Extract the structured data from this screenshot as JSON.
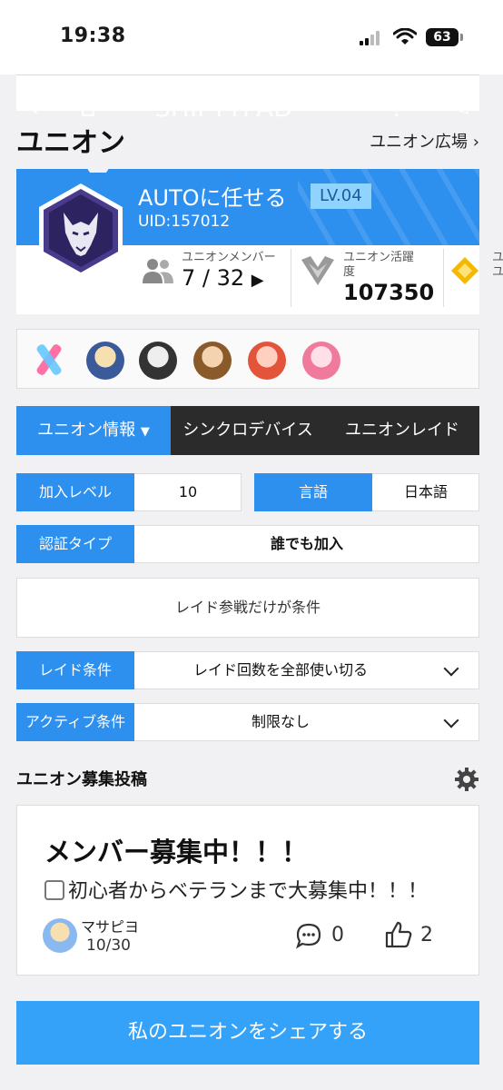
{
  "status_bar": {
    "time": "19:38",
    "battery": "63"
  },
  "nav": {
    "ghost_brand": "SHIFTYPAD"
  },
  "header": {
    "title": "ユニオン",
    "plaza_link": "ユニオン広場"
  },
  "union": {
    "name": "AUTOに任せる",
    "level": "LV.04",
    "uid": "UID:157012",
    "members_label": "ユニオンメンバー",
    "members_value": "7 / 32",
    "activity_label_1": "ユニオン活躍",
    "activity_label_2": "度",
    "activity_value": "107350",
    "extra_label_1": "ユ",
    "extra_label_2": "ユ"
  },
  "tabs": [
    {
      "label": "ユニオン情報"
    },
    {
      "label": "シンクロデバイス"
    },
    {
      "label": "ユニオンレイド"
    }
  ],
  "info": {
    "join_level_label": "加入レベル",
    "join_level_value": "10",
    "language_label": "言語",
    "language_value": "日本語",
    "auth_label": "認証タイプ",
    "auth_value": "誰でも加入",
    "condition_text": "レイド参戦だけが条件",
    "raid_label": "レイド条件",
    "raid_value": "レイド回数を全部使い切る",
    "active_label": "アクティブ条件",
    "active_value": "制限なし"
  },
  "post": {
    "section_title": "ユニオン募集投稿",
    "title": "メンバー募集中！！！",
    "body": "初心者からベテランまで大募集中！！！",
    "user": "マサピヨ",
    "members": "10/30",
    "comments": "0",
    "likes": "2"
  },
  "share_button": "私のユニオンをシェアする",
  "colors": {
    "accent": "#2d8fee",
    "share": "#35a2fa",
    "emblem": "#4a3a8c"
  }
}
